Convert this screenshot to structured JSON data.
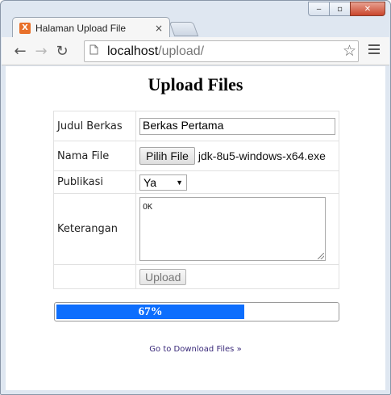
{
  "window": {
    "tab_title": "Halaman Upload File",
    "tab_close": "×",
    "favicon": "X",
    "controls": {
      "minimize": "‒",
      "maximize": "▫",
      "close": "✕"
    }
  },
  "toolbar": {
    "url_host": "localhost",
    "url_path": "/upload/",
    "back": "←",
    "forward": "→",
    "reload": "↻",
    "bookmark": "☆"
  },
  "page": {
    "title": "Upload Files",
    "form": {
      "judul_label": "Judul Berkas",
      "judul_value": "Berkas Pertama",
      "nama_label": "Nama File",
      "file_button": "Pilih File",
      "file_name": "jdk-8u5-windows-x64.exe",
      "publikasi_label": "Publikasi",
      "publikasi_value": "Ya",
      "keterangan_label": "Keterangan",
      "keterangan_value": "OK",
      "upload_button": "Upload"
    },
    "progress": {
      "percent": 67,
      "label": "67%",
      "color": "#0d6efd"
    },
    "download_link": "Go to Download Files »"
  }
}
